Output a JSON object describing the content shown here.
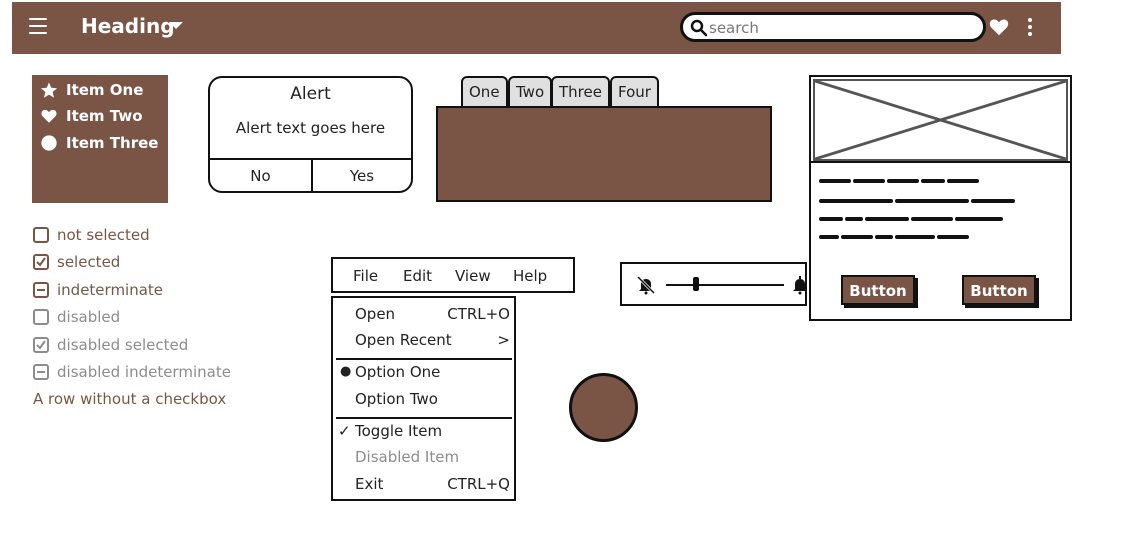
{
  "header": {
    "title": "Heading",
    "search_placeholder": "search",
    "search_value": ""
  },
  "sidebar": {
    "items": [
      {
        "label": "Item One",
        "icon": "star-icon"
      },
      {
        "label": "Item Two",
        "icon": "heart-icon"
      },
      {
        "label": "Item Three",
        "icon": "circle-icon"
      }
    ]
  },
  "checkboxes": [
    {
      "label": "not selected",
      "state": "unchecked",
      "disabled": false
    },
    {
      "label": "selected",
      "state": "checked",
      "disabled": false
    },
    {
      "label": "indeterminate",
      "state": "indeterminate",
      "disabled": false
    },
    {
      "label": "disabled",
      "state": "unchecked",
      "disabled": true
    },
    {
      "label": "disabled selected",
      "state": "checked",
      "disabled": true
    },
    {
      "label": "disabled indeterminate",
      "state": "indeterminate",
      "disabled": true
    },
    {
      "label": "A row without a checkbox",
      "state": "none",
      "disabled": false
    }
  ],
  "alert": {
    "title": "Alert",
    "text": "Alert text goes here",
    "no_label": "No",
    "yes_label": "Yes"
  },
  "tabs": [
    "One",
    "Two",
    "Three",
    "Four"
  ],
  "card": {
    "button1": "Button",
    "button2": "Button"
  },
  "menubar": [
    "File",
    "Edit",
    "View",
    "Help"
  ],
  "dropdown": [
    {
      "label": "Open",
      "shortcut": "CTRL+O"
    },
    {
      "label": "Open Recent",
      "shortcut": ">"
    },
    {
      "label": "Option One",
      "marker": "●"
    },
    {
      "label": "Option Two"
    },
    {
      "label": "Toggle Item",
      "marker": "✓"
    },
    {
      "label": "Disabled Item",
      "disabled": true
    },
    {
      "label": "Exit",
      "shortcut": "CTRL+Q"
    }
  ],
  "slider": {
    "value": 0.25
  },
  "colors": {
    "brand": "#7a5546",
    "disabled": "#8c8c8c"
  }
}
